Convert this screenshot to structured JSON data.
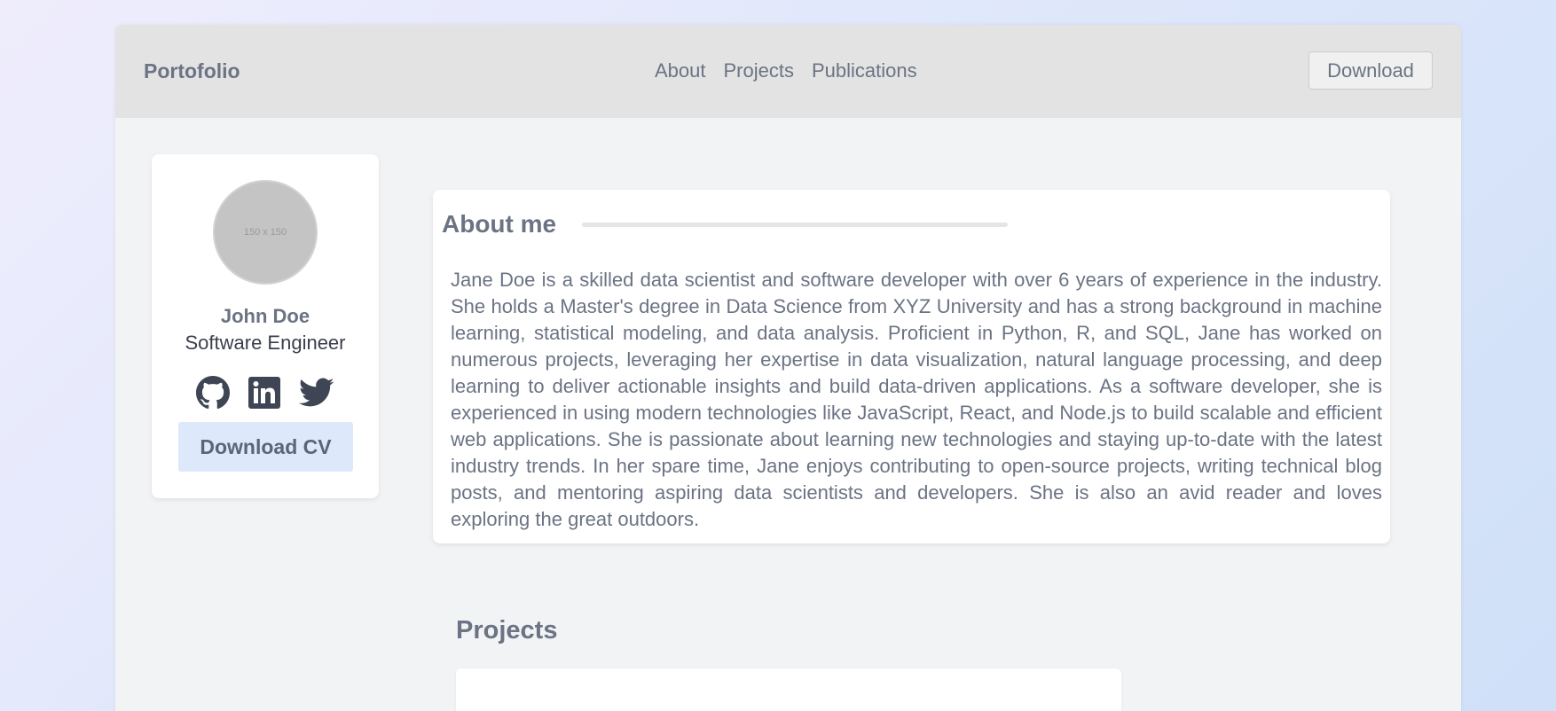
{
  "navbar": {
    "brand": "Portofolio",
    "links": [
      "About",
      "Projects",
      "Publications"
    ],
    "download_label": "Download"
  },
  "profile": {
    "avatar_placeholder": "150 x 150",
    "name": "John Doe",
    "role": "Software Engineer",
    "socials": [
      "github-icon",
      "linkedin-icon",
      "twitter-icon"
    ],
    "cv_button_label": "Download CV"
  },
  "about": {
    "title": "About me",
    "text": "Jane Doe is a skilled data scientist and software developer with over 6 years of experience in the industry. She holds a Master's degree in Data Science from XYZ University and has a strong background in machine learning, statistical modeling, and data analysis. Proficient in Python, R, and SQL, Jane has worked on numerous projects, leveraging her expertise in data visualization, natural language processing, and deep learning to deliver actionable insights and build data-driven applications. As a software developer, she is experienced in using modern technologies like JavaScript, React, and Node.js to build scalable and efficient web applications. She is passionate about learning new technologies and staying up-to-date with the latest industry trends. In her spare time, Jane enjoys contributing to open-source projects, writing technical blog posts, and mentoring aspiring data scientists and developers. She is also an avid reader and loves exploring the great outdoors."
  },
  "projects": {
    "title": "Projects"
  },
  "colors": {
    "text_muted": "#6b7384",
    "navbar_bg": "#e3e3e3",
    "cv_button_bg": "#dde9fb"
  }
}
